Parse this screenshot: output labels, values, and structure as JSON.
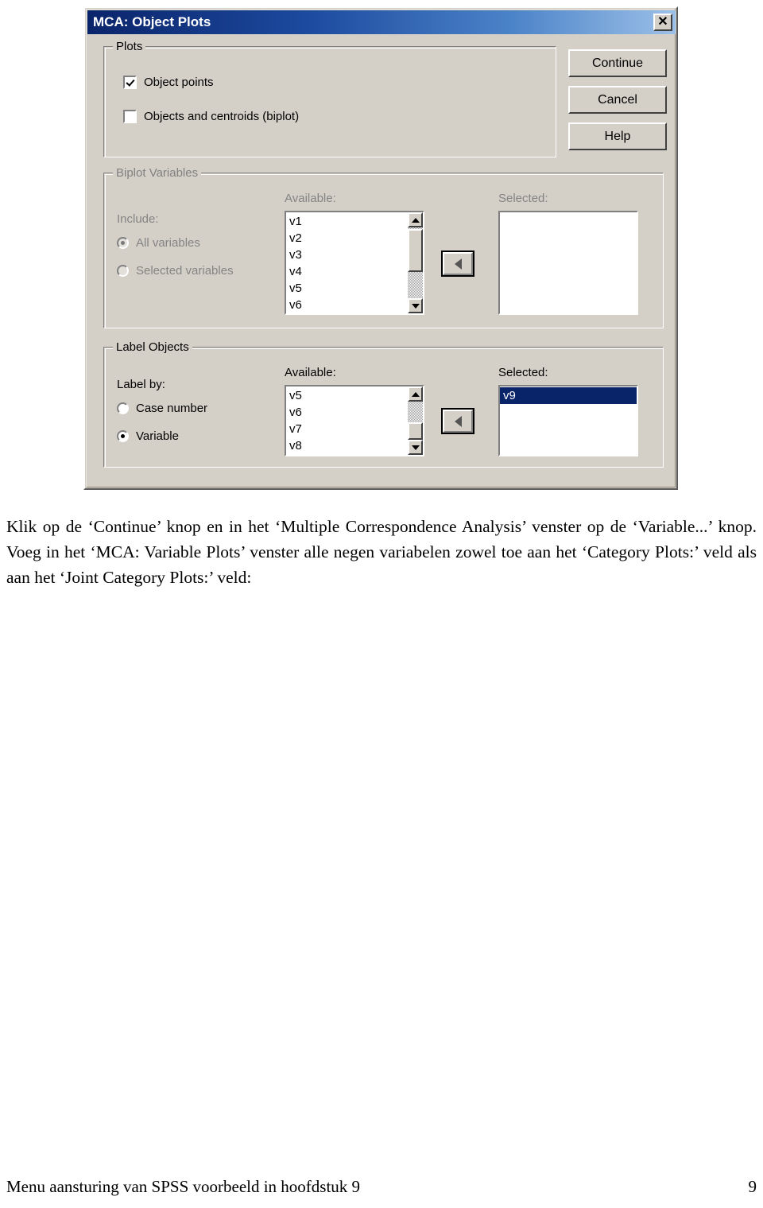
{
  "dialog": {
    "title": "MCA: Object Plots",
    "close_label": "✕",
    "buttons": {
      "continue": "Continue",
      "cancel": "Cancel",
      "help": "Help"
    },
    "plots_group": {
      "legend": "Plots",
      "checkboxes": [
        {
          "label": "Object points",
          "checked": true
        },
        {
          "label": "Objects and centroids (biplot)",
          "checked": false
        }
      ]
    },
    "biplot_group": {
      "legend": "Biplot Variables",
      "include_label": "Include:",
      "radios": [
        {
          "label": "All variables",
          "selected": true
        },
        {
          "label": "Selected variables",
          "selected": false
        }
      ],
      "available_label": "Available:",
      "selected_label": "Selected:",
      "available_items": [
        "v1",
        "v2",
        "v3",
        "v4",
        "v5",
        "v6"
      ],
      "selected_items": [],
      "transfer_icon": "left-arrow"
    },
    "label_group": {
      "legend": "Label Objects",
      "label_by_label": "Label by:",
      "radios": [
        {
          "label": "Case number",
          "selected": false
        },
        {
          "label": "Variable",
          "selected": true
        }
      ],
      "available_label": "Available:",
      "selected_label": "Selected:",
      "available_items": [
        "v5",
        "v6",
        "v7",
        "v8"
      ],
      "selected_items": [
        {
          "label": "v9",
          "highlighted": true
        }
      ],
      "transfer_icon": "left-arrow"
    },
    "colors": {
      "face": "#d4d0c8",
      "title_start": "#0a246a",
      "title_end": "#9cc0e8",
      "selection": "#0a246a",
      "disabled_text": "#848484"
    }
  },
  "page": {
    "paragraph": "Klik op de ‘Continue’ knop en in het ‘Multiple Correspondence Analysis’ venster op de ‘Variable...’ knop. Voeg in het ‘MCA: Variable Plots’ venster alle negen variabelen zowel toe aan het ‘Category Plots:’ veld als aan het ‘Joint Category Plots:’ veld:",
    "footer_text": "Menu aansturing van SPSS voorbeeld in hoofdstuk 9",
    "page_number": "9"
  }
}
